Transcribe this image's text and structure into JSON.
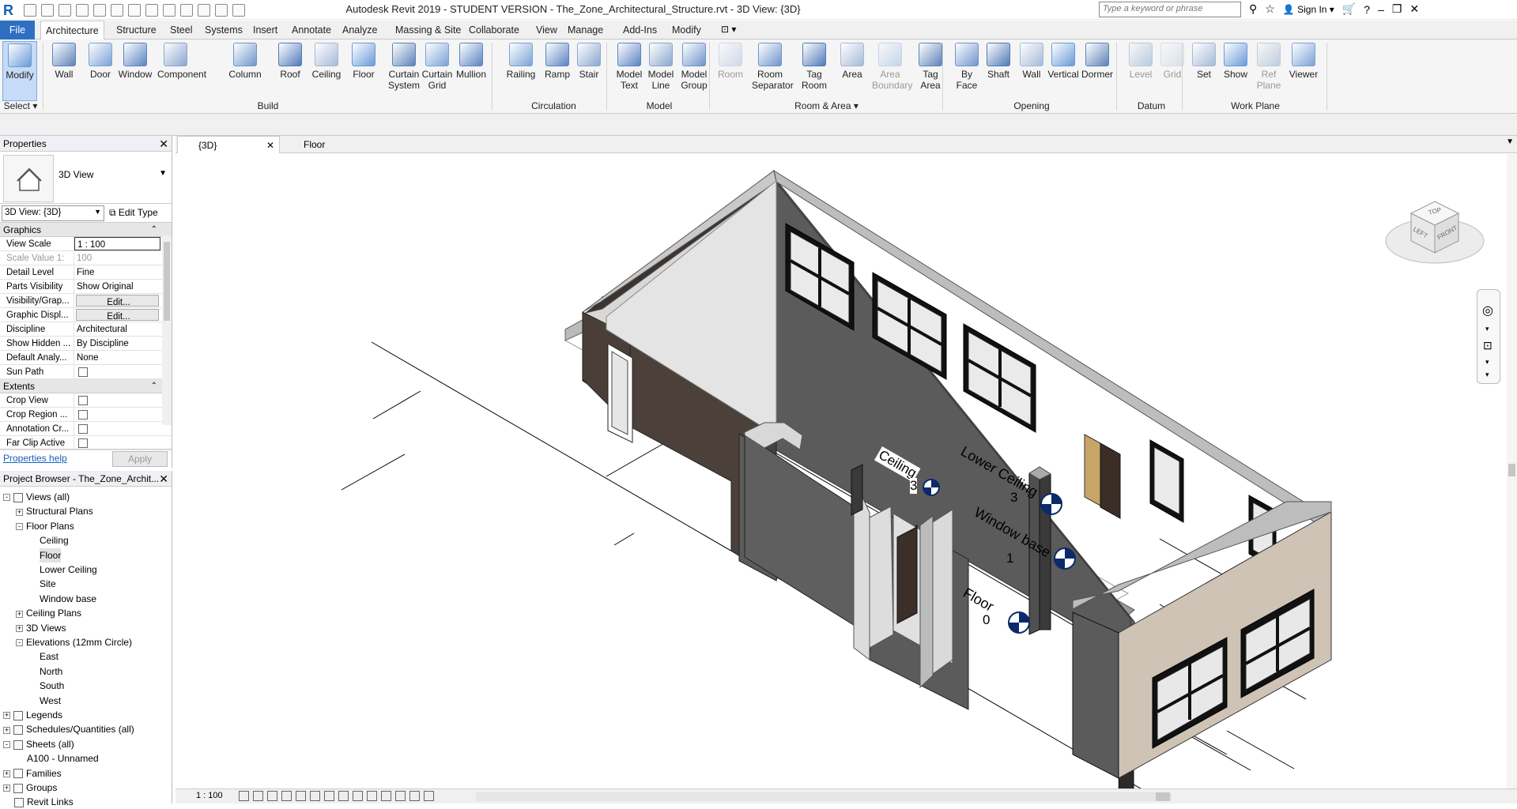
{
  "window": {
    "title": "Autodesk Revit 2019 - STUDENT VERSION - The_Zone_Architectural_Structure.rvt - 3D View: {3D}",
    "search_placeholder": "Type a keyword or phrase",
    "sign_in": "Sign In"
  },
  "tabs": [
    "File",
    "Architecture",
    "Structure",
    "Steel",
    "Systems",
    "Insert",
    "Annotate",
    "Analyze",
    "Massing & Site",
    "Collaborate",
    "View",
    "Manage",
    "Add-Ins",
    "Modify"
  ],
  "active_tab": "Architecture",
  "ribbon": {
    "select": {
      "tools": [
        {
          "l1": "Modify",
          "l2": ""
        }
      ],
      "title": "Select ▾"
    },
    "build": {
      "tools": [
        {
          "l1": "Wall",
          "l2": ""
        },
        {
          "l1": "Door",
          "l2": ""
        },
        {
          "l1": "Window",
          "l2": ""
        },
        {
          "l1": "Component",
          "l2": ""
        },
        {
          "l1": "Column",
          "l2": ""
        },
        {
          "l1": "Roof",
          "l2": ""
        },
        {
          "l1": "Ceiling",
          "l2": ""
        },
        {
          "l1": "Floor",
          "l2": ""
        },
        {
          "l1": "Curtain",
          "l2": "System"
        },
        {
          "l1": "Curtain",
          "l2": "Grid"
        },
        {
          "l1": "Mullion",
          "l2": ""
        }
      ],
      "title": "Build"
    },
    "circulation": {
      "tools": [
        {
          "l1": "Railing",
          "l2": ""
        },
        {
          "l1": "Ramp",
          "l2": ""
        },
        {
          "l1": "Stair",
          "l2": ""
        }
      ],
      "title": "Circulation"
    },
    "model": {
      "tools": [
        {
          "l1": "Model",
          "l2": "Text"
        },
        {
          "l1": "Model",
          "l2": "Line"
        },
        {
          "l1": "Model",
          "l2": "Group"
        }
      ],
      "title": "Model"
    },
    "room": {
      "tools": [
        {
          "l1": "Room",
          "l2": ""
        },
        {
          "l1": "Room",
          "l2": "Separator"
        },
        {
          "l1": "Tag",
          "l2": "Room"
        },
        {
          "l1": "Area",
          "l2": ""
        },
        {
          "l1": "Area",
          "l2": "Boundary"
        },
        {
          "l1": "Tag",
          "l2": "Area"
        }
      ],
      "title": "Room & Area ▾"
    },
    "opening": {
      "tools": [
        {
          "l1": "By",
          "l2": "Face"
        },
        {
          "l1": "Shaft",
          "l2": ""
        },
        {
          "l1": "Wall",
          "l2": ""
        },
        {
          "l1": "Vertical",
          "l2": ""
        },
        {
          "l1": "Dormer",
          "l2": ""
        }
      ],
      "title": "Opening"
    },
    "datum": {
      "tools": [
        {
          "l1": "Level",
          "l2": ""
        },
        {
          "l1": "Grid",
          "l2": ""
        }
      ],
      "title": "Datum"
    },
    "workplane": {
      "tools": [
        {
          "l1": "Set",
          "l2": ""
        },
        {
          "l1": "Show",
          "l2": ""
        },
        {
          "l1": "Ref",
          "l2": "Plane"
        },
        {
          "l1": "Viewer",
          "l2": ""
        }
      ],
      "title": "Work Plane"
    }
  },
  "properties": {
    "title": "Properties",
    "type_name": "3D View",
    "view_selector": "3D View: {3D}",
    "edit_type": "Edit Type",
    "groups": [
      {
        "name": "Graphics",
        "rows": [
          {
            "k": "View Scale",
            "v": "1 : 100"
          },
          {
            "k": "Scale Value    1:",
            "v": "100"
          },
          {
            "k": "Detail Level",
            "v": "Fine"
          },
          {
            "k": "Parts Visibility",
            "v": "Show Original"
          },
          {
            "k": "Visibility/Grap...",
            "v": "Edit..."
          },
          {
            "k": "Graphic Displ...",
            "v": "Edit..."
          },
          {
            "k": "Discipline",
            "v": "Architectural"
          },
          {
            "k": "Show Hidden ...",
            "v": "By Discipline"
          },
          {
            "k": "Default Analy...",
            "v": "None"
          },
          {
            "k": "Sun Path",
            "v": ""
          }
        ]
      },
      {
        "name": "Extents",
        "rows": [
          {
            "k": "Crop View",
            "v": ""
          },
          {
            "k": "Crop Region ...",
            "v": ""
          },
          {
            "k": "Annotation Cr...",
            "v": ""
          },
          {
            "k": "Far Clip Active",
            "v": ""
          }
        ]
      }
    ],
    "help": "Properties help",
    "apply": "Apply"
  },
  "browser": {
    "title": "Project Browser - The_Zone_Archit...",
    "nodes": [
      {
        "t": "Views (all)",
        "lvl": 0,
        "exp": "-",
        "ico": true
      },
      {
        "t": "Structural Plans",
        "lvl": 1,
        "exp": "+"
      },
      {
        "t": "Floor Plans",
        "lvl": 1,
        "exp": "-"
      },
      {
        "t": "Ceiling",
        "lvl": 2
      },
      {
        "t": "Floor",
        "lvl": 2,
        "hl": true
      },
      {
        "t": "Lower Ceiling",
        "lvl": 2
      },
      {
        "t": "Site",
        "lvl": 2
      },
      {
        "t": "Window base",
        "lvl": 2
      },
      {
        "t": "Ceiling Plans",
        "lvl": 1,
        "exp": "+"
      },
      {
        "t": "3D Views",
        "lvl": 1,
        "exp": "+"
      },
      {
        "t": "Elevations (12mm Circle)",
        "lvl": 1,
        "exp": "-"
      },
      {
        "t": "East",
        "lvl": 2
      },
      {
        "t": "North",
        "lvl": 2
      },
      {
        "t": "South",
        "lvl": 2
      },
      {
        "t": "West",
        "lvl": 2
      },
      {
        "t": "Legends",
        "lvl": 0,
        "exp": "+",
        "ico": true
      },
      {
        "t": "Schedules/Quantities (all)",
        "lvl": 0,
        "exp": "+",
        "ico": true
      },
      {
        "t": "Sheets (all)",
        "lvl": 0,
        "exp": "-",
        "ico": true
      },
      {
        "t": "A100 - Unnamed",
        "lvl": 1
      },
      {
        "t": "Families",
        "lvl": 0,
        "exp": "+",
        "ico": true
      },
      {
        "t": "Groups",
        "lvl": 0,
        "exp": "+",
        "ico": true
      },
      {
        "t": "Revit Links",
        "lvl": 0,
        "ico": true
      }
    ]
  },
  "view_tabs": [
    "{3D}",
    "Floor"
  ],
  "levels": [
    {
      "name": "Lower Ceiling",
      "num": "3"
    },
    {
      "name": "Window base",
      "num": "1"
    },
    {
      "name": "Floor",
      "num": "0"
    },
    {
      "name": "Ceiling",
      "num": "3"
    }
  ],
  "viewcube": {
    "top": "TOP",
    "left": "LEFT",
    "front": "FRONT"
  },
  "status": {
    "scale": "1 : 100"
  }
}
